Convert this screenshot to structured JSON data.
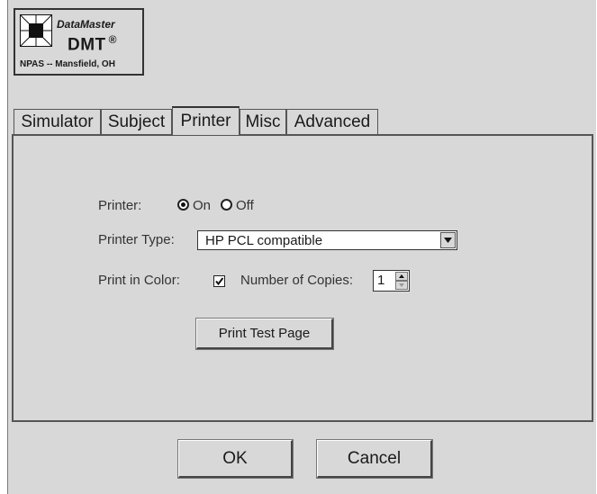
{
  "logo": {
    "product": "DataMaster",
    "model": "DMT",
    "reg_mark": "®",
    "agency": "NPAS -- Mansfield, OH",
    "icon": "datamaster-logo-icon"
  },
  "tabs": [
    {
      "label": "Simulator",
      "active": false
    },
    {
      "label": "Subject",
      "active": false
    },
    {
      "label": "Printer",
      "active": true
    },
    {
      "label": "Misc",
      "active": false
    },
    {
      "label": "Advanced",
      "active": false
    }
  ],
  "printer": {
    "printer_label": "Printer:",
    "on_label": "On",
    "off_label": "Off",
    "selected": "On",
    "type_label": "Printer Type:",
    "type_value": "HP PCL compatible",
    "color_label": "Print in Color:",
    "color_checked": true,
    "copies_label": "Number of Copies:",
    "copies_value": "1",
    "test_button": "Print Test Page"
  },
  "footer": {
    "ok": "OK",
    "cancel": "Cancel"
  },
  "colors": {
    "background": "#d8d8d8",
    "border": "#555555"
  }
}
